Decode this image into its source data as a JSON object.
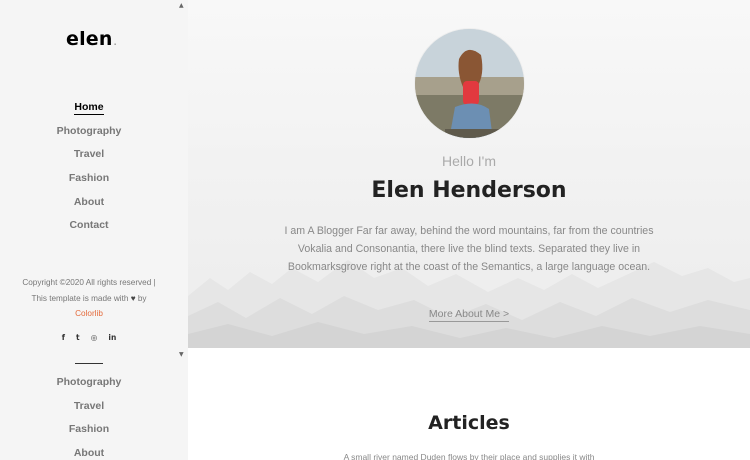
{
  "sidebar": {
    "logo": "elen",
    "logo_dot": ".",
    "nav": [
      {
        "label": "Home",
        "active": true
      },
      {
        "label": "Photography"
      },
      {
        "label": "Travel"
      },
      {
        "label": "Fashion"
      },
      {
        "label": "About"
      },
      {
        "label": "Contact"
      }
    ],
    "copyright_line1": "Copyright ©2020 All rights reserved | This template is made with",
    "heart": "♥",
    "by": "by",
    "brand": "Colorlib",
    "social": [
      {
        "icon": "facebook-icon",
        "glyph": "f"
      },
      {
        "icon": "twitter-icon",
        "glyph": "t"
      },
      {
        "icon": "instagram-icon",
        "glyph": "◎"
      },
      {
        "icon": "linkedin-icon",
        "glyph": "in"
      }
    ],
    "nav_repeat": [
      {
        "label": "Photography"
      },
      {
        "label": "Travel"
      },
      {
        "label": "Fashion"
      },
      {
        "label": "About"
      }
    ]
  },
  "hero": {
    "greeting": "Hello I'm",
    "name": "Elen Henderson",
    "bio": "I am A Blogger Far far away, behind the word mountains, far from the countries Vokalia and Consonantia, there live the blind texts. Separated they live in Bookmarksgrove right at the coast of the Semantics, a large language ocean.",
    "more_link": "More About Me >"
  },
  "articles": {
    "title": "Articles",
    "intro": "A small river named Duden flows by their place and supplies it with"
  },
  "colors": {
    "accent": "#e46b3c",
    "sidebar_bg": "#f5f5f5"
  }
}
